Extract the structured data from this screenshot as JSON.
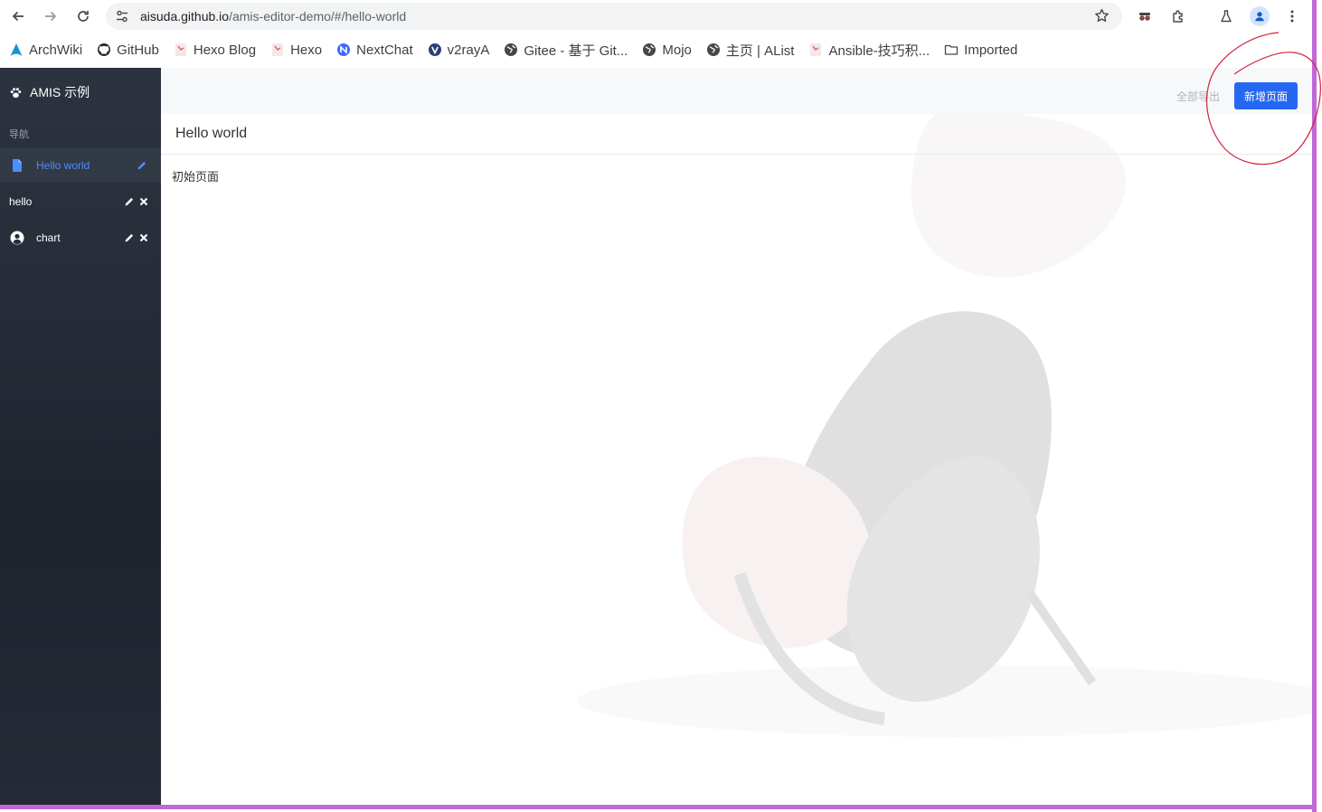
{
  "browser": {
    "url_host": "aisuda.github.io",
    "url_path": "/amis-editor-demo/#/hello-world",
    "nav": {
      "back_icon": "arrow-left-icon",
      "forward_icon": "arrow-right-icon",
      "reload_icon": "reload-icon"
    },
    "extensions": [
      "incognito-glasses-icon",
      "puzzle-extension-icon",
      "flask-labs-icon"
    ],
    "profile_icon": "profile-avatar-icon",
    "menu_icon": "kebab-menu-icon"
  },
  "bookmarks": [
    {
      "label": "ArchWiki",
      "icon": "archlinux-icon"
    },
    {
      "label": "GitHub",
      "icon": "github-icon"
    },
    {
      "label": "Hexo Blog",
      "icon": "hexo-blog-icon"
    },
    {
      "label": "Hexo",
      "icon": "hexo-icon"
    },
    {
      "label": "NextChat",
      "icon": "nextchat-icon"
    },
    {
      "label": "v2rayA",
      "icon": "v2raya-icon"
    },
    {
      "label": "Gitee - 基于 Git...",
      "icon": "globe-icon"
    },
    {
      "label": "Mojo",
      "icon": "globe-icon"
    },
    {
      "label": "主页 | AList",
      "icon": "globe-icon"
    },
    {
      "label": "Ansible-技巧积...",
      "icon": "ansible-icon"
    },
    {
      "label": "Imported",
      "icon": "folder-icon"
    }
  ],
  "sidebar": {
    "brand": "AMIS 示例",
    "nav_label": "导航",
    "items": [
      {
        "label": "Hello world",
        "active": true,
        "icon": "file-icon"
      },
      {
        "label": "hello",
        "active": false
      },
      {
        "label": "chart",
        "active": false,
        "icon": "user-circle-icon"
      }
    ]
  },
  "main": {
    "export_label": "全部导出",
    "new_page_label": "新增页面",
    "page_title": "Hello world",
    "page_body": "初始页面"
  },
  "colors": {
    "accent": "#2468f2",
    "active_link": "#4c8dff",
    "sidebar_bg": "#262c37",
    "frame": "#c068d8",
    "annotation": "#d0213a"
  }
}
